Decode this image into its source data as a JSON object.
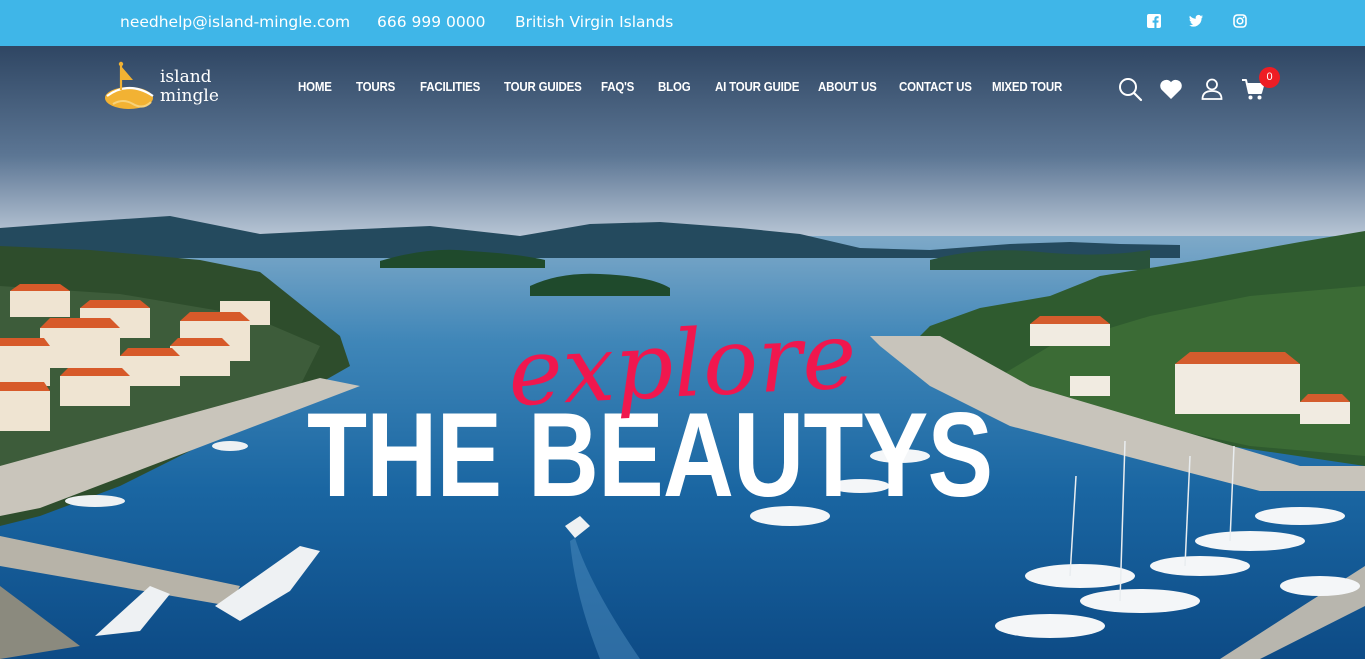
{
  "topbar": {
    "email": "needhelp@island-mingle.com",
    "phone": "666 999 0000",
    "location": "British Virgin Islands",
    "social_icons": [
      "facebook-icon",
      "twitter-icon",
      "instagram-icon"
    ]
  },
  "header": {
    "logo": {
      "line1": "island",
      "line2": "mingle"
    },
    "nav": [
      "HOME",
      "TOURS",
      "FACILITIES",
      "TOUR GUIDES",
      "FAQ'S",
      "BLOG",
      "AI TOUR GUIDE",
      "ABOUT US",
      "CONTACT US",
      "MIXED TOUR"
    ],
    "icons": [
      "search-icon",
      "heart-icon",
      "user-icon",
      "cart-icon"
    ],
    "cart_count": "0"
  },
  "hero": {
    "script_text": "explore",
    "headline": "THE BEAUTYS"
  },
  "colors": {
    "topbar": "#3fb6e8",
    "accent": "#f0174e",
    "badge": "#ee1d24",
    "logo_gold": "#f2b233"
  }
}
